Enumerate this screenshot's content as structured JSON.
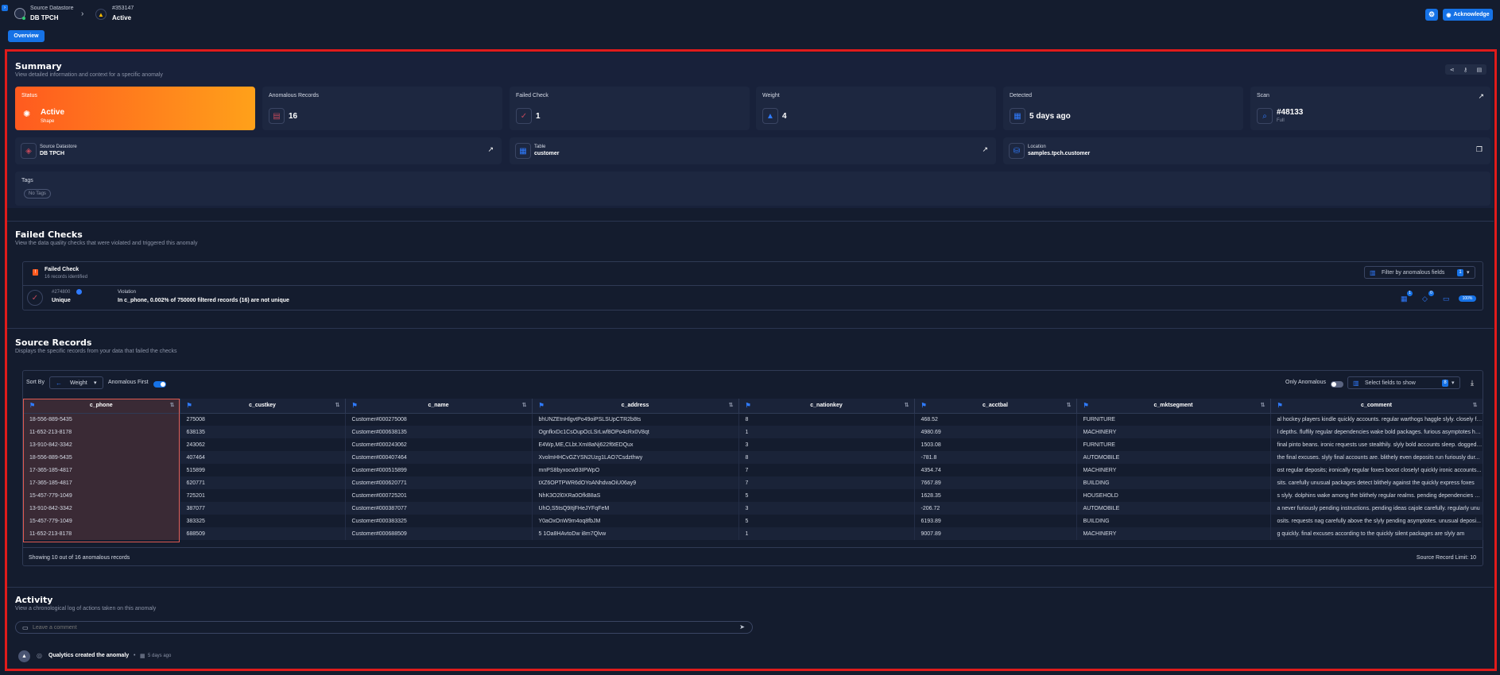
{
  "header": {
    "source_label": "Source Datastore",
    "source_name": "DB TPCH",
    "anomaly_id": "#353147",
    "anomaly_status": "Active",
    "acknowledge_label": "Acknowledge"
  },
  "tabs": {
    "overview": "Overview"
  },
  "summary": {
    "title": "Summary",
    "subtitle": "View detailed information and context for a specific anomaly",
    "status": {
      "label": "Status",
      "value": "Active",
      "sub": "Shape"
    },
    "anomalous_records": {
      "label": "Anomalous Records",
      "value": "16"
    },
    "failed_check": {
      "label": "Failed Check",
      "value": "1"
    },
    "weight": {
      "label": "Weight",
      "value": "4"
    },
    "detected": {
      "label": "Detected",
      "value": "5 days ago"
    },
    "scan": {
      "label": "Scan",
      "value": "#48133",
      "sub": "Full"
    },
    "source_datastore": {
      "label": "Source Datastore",
      "value": "DB TPCH"
    },
    "table": {
      "label": "Table",
      "value": "customer"
    },
    "location": {
      "label": "Location",
      "value": "samples.tpch.customer"
    },
    "tags": {
      "label": "Tags",
      "value": "No Tags"
    }
  },
  "failed_checks": {
    "title": "Failed Checks",
    "subtitle": "View the data quality checks that were violated and triggered this anomaly",
    "header_label": "Failed Check",
    "header_sub": "16 records identified",
    "filter_label": "Filter by anomalous fields",
    "filter_count": "1",
    "check_id": "#274800",
    "check_type": "Unique",
    "violation_label": "Violation",
    "violation_text": "In c_phone, 0.002% of 750000 filtered records (16) are not unique",
    "badge1": "1",
    "badge2": "0",
    "coverage": "100%"
  },
  "source_records": {
    "title": "Source Records",
    "subtitle": "Displays the specific records from your data that failed the checks",
    "sort_by_label": "Sort By",
    "sort_value": "Weight",
    "anomalous_first_label": "Anomalous First",
    "only_anomalous_label": "Only Anomalous",
    "select_fields_label": "Select fields to show",
    "select_fields_count": "8",
    "columns": [
      "c_phone",
      "c_custkey",
      "c_name",
      "c_address",
      "c_nationkey",
      "c_acctbal",
      "c_mktsegment",
      "c_comment"
    ],
    "rows": [
      [
        "18-556-889-5435",
        "275008",
        "Customer#000275008",
        "bhUNZEtnHlgvtPo49oiPSLSUpCTR2b8ts",
        "8",
        "468.52",
        "FURNITURE",
        "al hockey players kindle quickly accounts. regular warthogs haggle slyly. closely fi..."
      ],
      [
        "11-652-213-8178",
        "638135",
        "Customer#000638135",
        "OgnfkxDc1CsOupOcLSrLwf8OPo4cRx0V8qt",
        "1",
        "4980.69",
        "MACHINERY",
        "l depths. fluffily regular dependencies wake bold packages. furious asymptotes ha..."
      ],
      [
        "13-910-842-3342",
        "243062",
        "Customer#000243062",
        "E4Wp,ME,CLbt.XmI8aNj622f6tEDQux",
        "3",
        "1503.08",
        "FURNITURE",
        "final pinto beans. ironic requests use stealthily. slyly bold accounts sleep. dogged ..."
      ],
      [
        "18-556-889-5435",
        "407464",
        "Customer#000407464",
        "XvolmHHCvGZYSN2Uzg1LAO7Csdzthwy",
        "8",
        "-781.8",
        "AUTOMOBILE",
        "the final excuses. slyly final accounts are. blithely even deposits run furiously dur..."
      ],
      [
        "17-365-185-4817",
        "515899",
        "Customer#000515899",
        "mnPS8byxocw93IPWpO",
        "7",
        "4354.74",
        "MACHINERY",
        "ost regular deposits; ironically regular foxes boost closely! quickly ironic accounts..."
      ],
      [
        "17-365-185-4817",
        "620771",
        "Customer#000620771",
        "tXZ6OPTPWR6dOYoANhdvaOiU06ay9",
        "7",
        "7667.89",
        "BUILDING",
        "sits. carefully unusual packages detect blithely against the quickly express foxes"
      ],
      [
        "15-457-779-1049",
        "725201",
        "Customer#000725201",
        "NhK3O2l0XRa0OfkB8aS",
        "5",
        "1628.35",
        "HOUSEHOLD",
        "s slyly. dolphins wake among the blithely regular realms. pending dependencies sl..."
      ],
      [
        "13-910-842-3342",
        "387077",
        "Customer#000387077",
        "UhO,S5tsQ9ItjFHeJYFqFeM",
        "3",
        "-206.72",
        "AUTOMOBILE",
        "a never furiously pending instructions. pending ideas cajole carefully. regularly unu"
      ],
      [
        "15-457-779-1049",
        "383325",
        "Customer#000383325",
        "Y0aOxOnW9m4oq8fbJM",
        "5",
        "6193.89",
        "BUILDING",
        "osits. requests nag carefully above the slyly pending asymptotes. unusual deposi..."
      ],
      [
        "11-652-213-8178",
        "688509",
        "Customer#000688509",
        "5 1Oa8HAvtoDw i8m7Qlvw",
        "1",
        "9007.89",
        "MACHINERY",
        "g quickly. final excuses according to the quickly silent packages are slyly am"
      ]
    ],
    "footer_left": "Showing 10 out of 16 anomalous records",
    "footer_right": "Source Record Limit: 10"
  },
  "activity": {
    "title": "Activity",
    "subtitle": "View a chronological log of actions taken on this anomaly",
    "comment_placeholder": "Leave a comment",
    "log_text": "Qualytics created the anomaly",
    "log_separator": "•",
    "log_time": "5 days ago"
  },
  "colors": {
    "background": "#141c2e",
    "card": "#1d2740",
    "accent": "#1672e6",
    "status_gradient_start": "#ff5a1f",
    "status_gradient_end": "#ffa11a",
    "highlight_border": "#e01b1b"
  }
}
